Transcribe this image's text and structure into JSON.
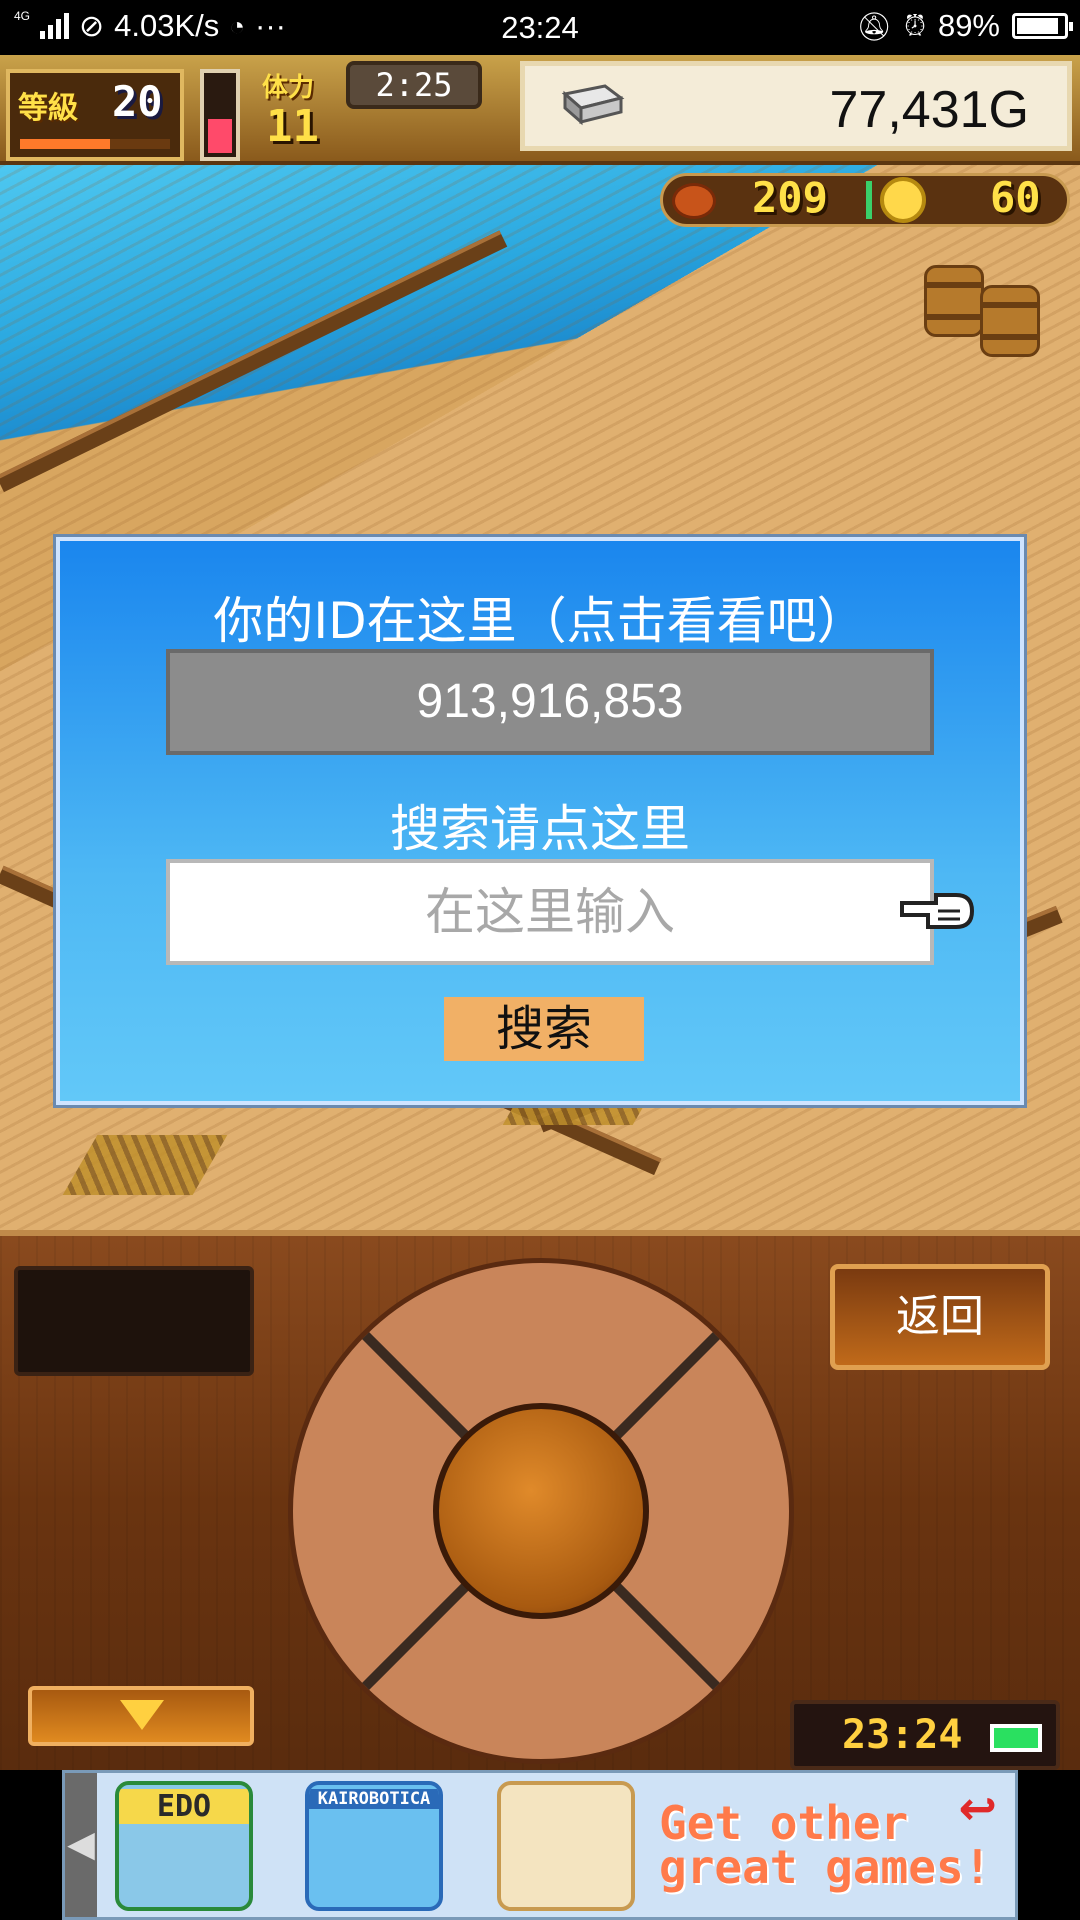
{
  "status_bar": {
    "network": "4G",
    "speed": "4.03K/s",
    "more": "···",
    "time": "23:24",
    "battery": "89%",
    "battery_level": 0.89
  },
  "hud": {
    "level_label": "等級",
    "level": "20",
    "level_exp_progress": 0.6,
    "stamina_label": "体力",
    "stamina": "11",
    "stamina_fill": 0.45,
    "timer": "2:25",
    "money": "77,431G",
    "food": "209",
    "coins": "60"
  },
  "dialog": {
    "title": "你的ID在这里（点击看看吧）",
    "player_id": "913,916,853",
    "search_label": "搜索请点这里",
    "search_placeholder": "在这里输入",
    "search_value": "",
    "search_button": "搜索"
  },
  "controls": {
    "back_button": "返回",
    "clock": "23:24"
  },
  "ad": {
    "games": [
      {
        "name": "EDO",
        "color": "#f6d84a"
      },
      {
        "name": "KAIROBOTICA",
        "color": "#4ab0e8"
      },
      {
        "name": "",
        "color": "#f4e4c0"
      }
    ],
    "cta_line1": "Get other",
    "cta_line2": "great games!",
    "return_icon": "↩"
  },
  "colors": {
    "dialog_top": "#1a86ee",
    "dialog_bottom": "#62c8f8",
    "search_button": "#f1b066",
    "id_box": "#8c8c8c"
  }
}
